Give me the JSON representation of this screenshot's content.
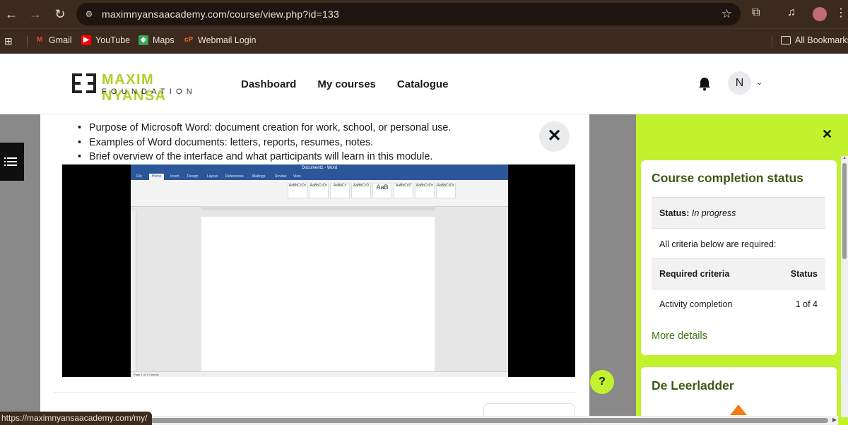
{
  "browser": {
    "url": "maximnyansaacademy.com/course/view.php?id=133",
    "status_url": "https://maximnyansaacademy.com/my/",
    "bookmarks": [
      {
        "label": "Gmail",
        "icon": "gmail-icon",
        "color": "#ea4335"
      },
      {
        "label": "YouTube",
        "icon": "youtube-icon",
        "color": "#ff0000"
      },
      {
        "label": "Maps",
        "icon": "maps-icon",
        "color": "#34a853"
      },
      {
        "label": "Webmail Login",
        "icon": "cpanel-icon",
        "color": "#ff6c2c"
      }
    ],
    "all_bookmarks": "All Bookmarks"
  },
  "site": {
    "logo_name": "MAXIM NYANSA",
    "logo_sub": "FOUNDATION",
    "nav": [
      "Dashboard",
      "My courses",
      "Catalogue"
    ],
    "user_initial": "N"
  },
  "content": {
    "bullets": [
      "Purpose of Microsoft Word: document creation for work, school, or personal use.",
      "Examples of Word documents: letters, reports, resumes, notes.",
      "Brief overview of the interface and what participants will learn in this module."
    ],
    "close": "✕"
  },
  "word_screenshot": {
    "title": "Document1 - Word",
    "tabs": [
      "File",
      "Home",
      "Insert",
      "Design",
      "Layout",
      "References",
      "Mailings",
      "Review",
      "View"
    ],
    "active_tab": "Home",
    "styles": [
      "AaBbCcDc",
      "AaBbCcDc",
      "AaBbCc",
      "AaBbCcD",
      "AaB",
      "AaBbCcD",
      "AaBbCcDc",
      "AaBbCcDc"
    ],
    "status": "Page 1 of 1    0 words"
  },
  "help": "?",
  "drawer": {
    "close": "✕",
    "block1": {
      "title": "Course completion status",
      "status_label": "Status:",
      "status_value": "In progress",
      "criteria_note": "All criteria below are required:",
      "header_criteria": "Required criteria",
      "header_status": "Status",
      "row_criteria": "Activity completion",
      "row_status": "1 of 4",
      "more": "More details"
    },
    "block2": {
      "title": "De Leerladder"
    }
  },
  "colors": {
    "accent": "#c1f22d",
    "block_title": "#3d5a13",
    "link": "#3f7a16",
    "chrome": "#3c2a1e"
  }
}
